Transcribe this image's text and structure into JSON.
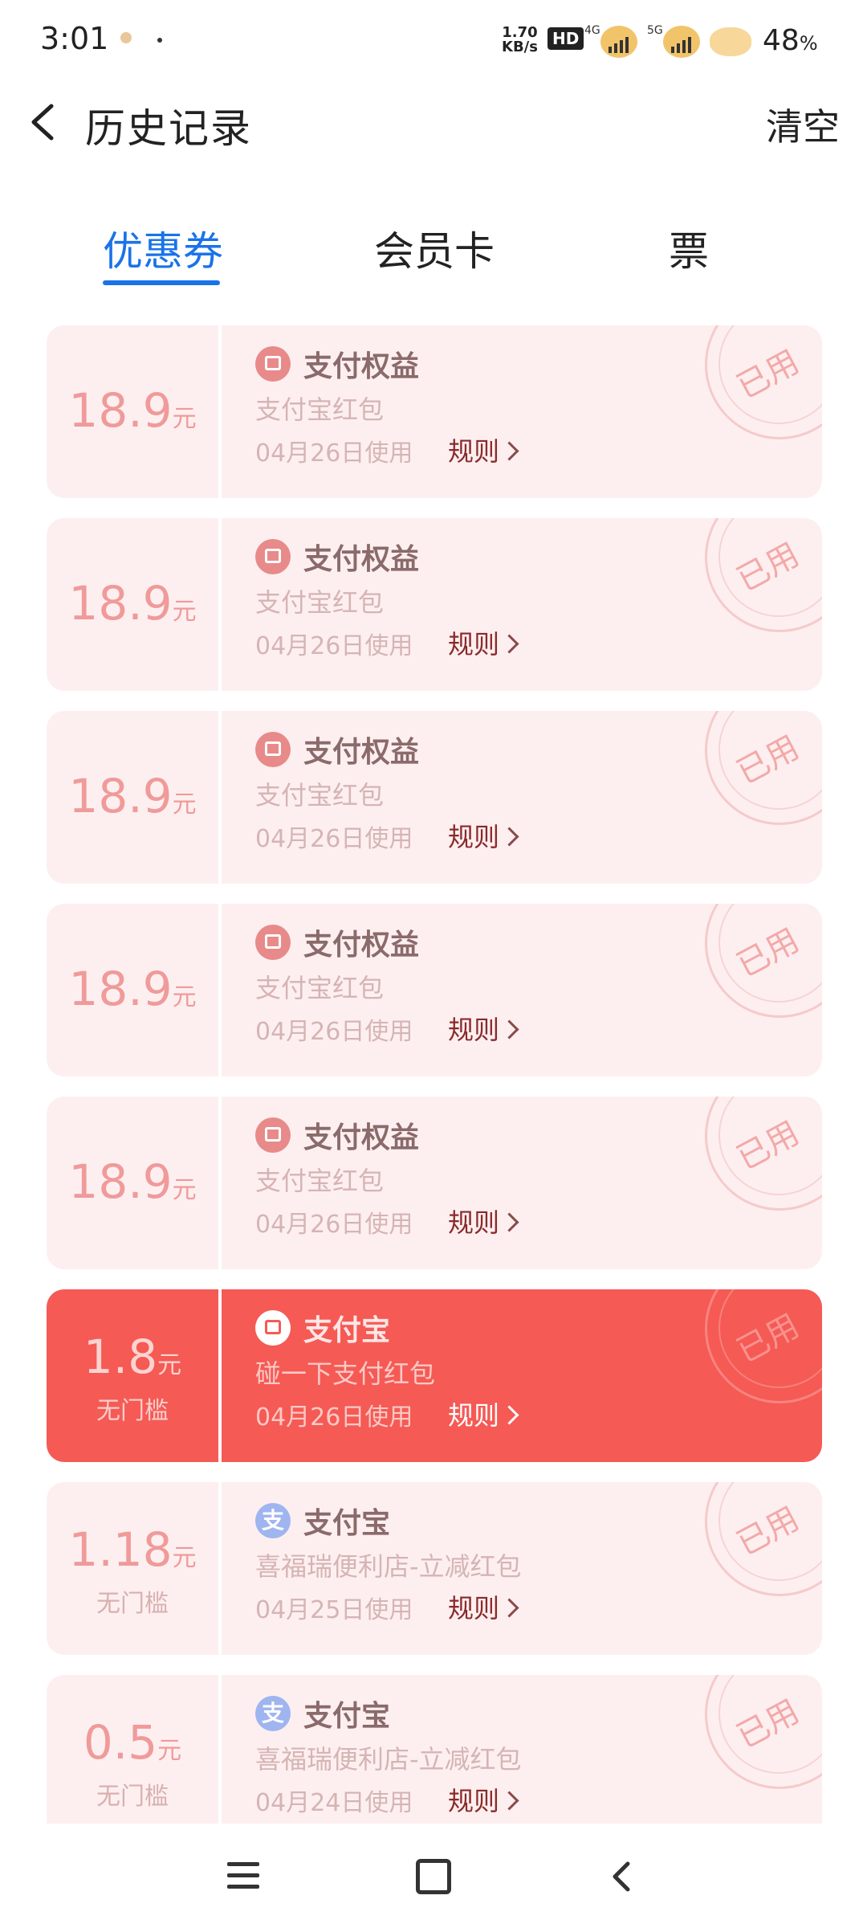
{
  "status_bar": {
    "time": "3:01",
    "net_speed_value": "1.70",
    "net_speed_unit": "KB/s",
    "hd_badge": "HD",
    "sim1_label": "4G",
    "sim2_label": "5G",
    "battery_value": "48",
    "battery_unit": "%"
  },
  "header": {
    "title": "历史记录",
    "clear_label": "清空",
    "back_icon": "chevron-left-icon"
  },
  "tabs": [
    {
      "label": "优惠券",
      "active": true
    },
    {
      "label": "会员卡",
      "active": false
    },
    {
      "label": "票",
      "active": false
    }
  ],
  "coupons": [
    {
      "amount": "18.9",
      "unit": "元",
      "sub": "",
      "icon": "red-packet-icon",
      "title": "支付权益",
      "desc": "支付宝红包",
      "date": "04月26日使用",
      "rule": "规则",
      "stamp": "已用"
    },
    {
      "amount": "18.9",
      "unit": "元",
      "sub": "",
      "icon": "red-packet-icon",
      "title": "支付权益",
      "desc": "支付宝红包",
      "date": "04月26日使用",
      "rule": "规则",
      "stamp": "已用"
    },
    {
      "amount": "18.9",
      "unit": "元",
      "sub": "",
      "icon": "red-packet-icon",
      "title": "支付权益",
      "desc": "支付宝红包",
      "date": "04月26日使用",
      "rule": "规则",
      "stamp": "已用"
    },
    {
      "amount": "18.9",
      "unit": "元",
      "sub": "",
      "icon": "red-packet-icon",
      "title": "支付权益",
      "desc": "支付宝红包",
      "date": "04月26日使用",
      "rule": "规则",
      "stamp": "已用"
    },
    {
      "amount": "18.9",
      "unit": "元",
      "sub": "",
      "icon": "red-packet-icon",
      "title": "支付权益",
      "desc": "支付宝红包",
      "date": "04月26日使用",
      "rule": "规则",
      "stamp": "已用"
    },
    {
      "amount": "1.8",
      "unit": "元",
      "sub": "无门槛",
      "icon": "red-packet-icon",
      "title": "支付宝",
      "desc": "碰一下支付红包",
      "date": "04月26日使用",
      "rule": "规则",
      "stamp": "已用",
      "highlight": true
    },
    {
      "amount": "1.18",
      "unit": "元",
      "sub": "无门槛",
      "icon": "alipay-icon",
      "title": "支付宝",
      "desc": "喜福瑞便利店-立减红包",
      "date": "04月25日使用",
      "rule": "规则",
      "stamp": "已用"
    },
    {
      "amount": "0.5",
      "unit": "元",
      "sub": "无门槛",
      "icon": "alipay-icon",
      "title": "支付宝",
      "desc": "喜福瑞便利店-立减红包",
      "date": "04月24日使用",
      "rule": "规则",
      "stamp": "已用"
    }
  ],
  "alipay_glyph": "支",
  "colors": {
    "accent": "#1a73e8",
    "card_bg": "#fdeff0",
    "card_highlight": "#f55a55",
    "amount": "#f09a9a"
  },
  "navbar": {
    "menu_icon": "menu-icon",
    "home_icon": "home-icon",
    "back_icon": "back-icon"
  }
}
